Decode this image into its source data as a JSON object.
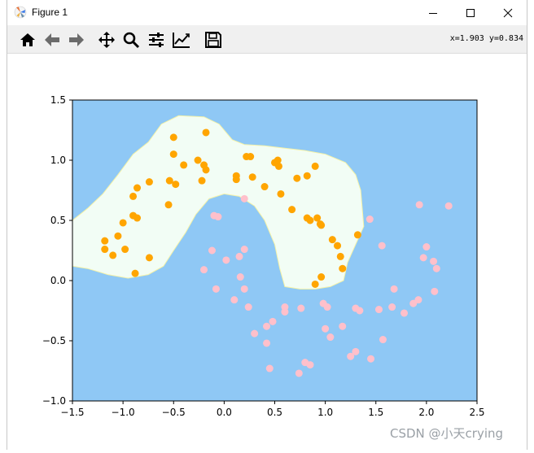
{
  "window": {
    "title": "Figure 1"
  },
  "toolbar": {
    "buttons": [
      "home-icon",
      "back-arrow-icon",
      "forward-arrow-icon",
      "pan-icon",
      "zoom-icon",
      "configure-subplots-icon",
      "edit-axis-icon",
      "save-icon"
    ],
    "coords": "x=1.903 y=0.834"
  },
  "watermark": "CSDN @小天crying",
  "colors": {
    "background": "#8fc8f5",
    "region": "#f2fdf5",
    "class0": "#ffa500",
    "class1": "#ffc0cb"
  },
  "chart_data": {
    "type": "scatter",
    "title": "",
    "xlabel": "",
    "ylabel": "",
    "xlim": [
      -1.5,
      2.5
    ],
    "ylim": [
      -1.0,
      1.5
    ],
    "xticks": [
      "−1.5",
      "−1.0",
      "−0.5",
      "0.0",
      "0.5",
      "1.0",
      "1.5",
      "2.0",
      "2.5"
    ],
    "yticks": [
      "1.5",
      "1.0",
      "0.5",
      "0.0",
      "−0.5",
      "−1.0"
    ],
    "xtick_values": [
      -1.5,
      -1.0,
      -0.5,
      0.0,
      0.5,
      1.0,
      1.5,
      2.0,
      2.5
    ],
    "ytick_values": [
      1.5,
      1.0,
      0.5,
      0.0,
      -0.5,
      -1.0
    ],
    "series": [
      {
        "color": "#ffa500",
        "points": [
          [
            -0.5,
            1.19
          ],
          [
            -0.18,
            1.23
          ],
          [
            -0.5,
            1.05
          ],
          [
            -0.4,
            0.96
          ],
          [
            -0.26,
            1.0
          ],
          [
            -0.2,
            0.96
          ],
          [
            -0.18,
            0.92
          ],
          [
            -0.22,
            0.83
          ],
          [
            0.22,
            1.03
          ],
          [
            0.26,
            1.03
          ],
          [
            0.12,
            0.87
          ],
          [
            0.12,
            0.84
          ],
          [
            0.28,
            0.86
          ],
          [
            0.4,
            0.78
          ],
          [
            0.5,
            0.98
          ],
          [
            0.53,
            1.0
          ],
          [
            0.54,
            0.95
          ],
          [
            0.56,
            0.72
          ],
          [
            0.67,
            0.59
          ],
          [
            0.72,
            0.85
          ],
          [
            0.82,
            0.87
          ],
          [
            0.9,
            0.95
          ],
          [
            0.82,
            0.52
          ],
          [
            0.85,
            0.5
          ],
          [
            0.92,
            0.52
          ],
          [
            0.95,
            0.47
          ],
          [
            0.96,
            0.46
          ],
          [
            -0.86,
            0.77
          ],
          [
            -0.74,
            0.82
          ],
          [
            -0.54,
            0.83
          ],
          [
            -0.48,
            0.8
          ],
          [
            -0.55,
            0.63
          ],
          [
            -0.9,
            0.7
          ],
          [
            -0.9,
            0.54
          ],
          [
            -0.86,
            0.52
          ],
          [
            -1.0,
            0.48
          ],
          [
            -1.05,
            0.37
          ],
          [
            -1.18,
            0.33
          ],
          [
            -1.18,
            0.26
          ],
          [
            -1.1,
            0.21
          ],
          [
            -0.98,
            0.26
          ],
          [
            -0.88,
            0.06
          ],
          [
            -0.74,
            0.19
          ],
          [
            1.07,
            0.34
          ],
          [
            1.12,
            0.29
          ],
          [
            1.15,
            0.2
          ],
          [
            1.17,
            0.1
          ],
          [
            1.32,
            0.38
          ],
          [
            0.96,
            0.03
          ],
          [
            0.9,
            -0.03
          ]
        ]
      },
      {
        "color": "#ffc0cb",
        "points": [
          [
            -0.1,
            0.54
          ],
          [
            -0.06,
            0.53
          ],
          [
            0.2,
            0.68
          ],
          [
            -0.12,
            0.25
          ],
          [
            -0.2,
            0.09
          ],
          [
            0.02,
            0.17
          ],
          [
            0.15,
            0.2
          ],
          [
            0.2,
            0.26
          ],
          [
            -0.08,
            -0.07
          ],
          [
            0.16,
            0.03
          ],
          [
            0.1,
            -0.16
          ],
          [
            0.2,
            -0.07
          ],
          [
            0.24,
            -0.22
          ],
          [
            0.3,
            -0.44
          ],
          [
            0.42,
            -0.38
          ],
          [
            0.48,
            -0.34
          ],
          [
            0.42,
            -0.52
          ],
          [
            0.45,
            -0.73
          ],
          [
            0.6,
            -0.22
          ],
          [
            0.6,
            -0.26
          ],
          [
            0.76,
            -0.23
          ],
          [
            0.74,
            -0.77
          ],
          [
            0.8,
            -0.68
          ],
          [
            0.85,
            -0.7
          ],
          [
            0.98,
            -0.19
          ],
          [
            1.02,
            -0.22
          ],
          [
            1.0,
            -0.4
          ],
          [
            1.05,
            -0.47
          ],
          [
            1.17,
            -0.38
          ],
          [
            1.25,
            -0.63
          ],
          [
            1.3,
            -0.59
          ],
          [
            1.3,
            -0.23
          ],
          [
            1.34,
            -0.25
          ],
          [
            1.45,
            -0.65
          ],
          [
            1.44,
            0.51
          ],
          [
            1.56,
            0.29
          ],
          [
            1.53,
            -0.24
          ],
          [
            1.57,
            -0.49
          ],
          [
            1.66,
            -0.22
          ],
          [
            1.68,
            -0.07
          ],
          [
            1.78,
            -0.27
          ],
          [
            1.87,
            -0.19
          ],
          [
            1.92,
            -0.16
          ],
          [
            1.93,
            0.63
          ],
          [
            1.97,
            0.19
          ],
          [
            2.0,
            0.28
          ],
          [
            2.07,
            0.16
          ],
          [
            2.1,
            0.1
          ],
          [
            2.08,
            -0.09
          ],
          [
            2.22,
            0.62
          ]
        ]
      }
    ]
  }
}
